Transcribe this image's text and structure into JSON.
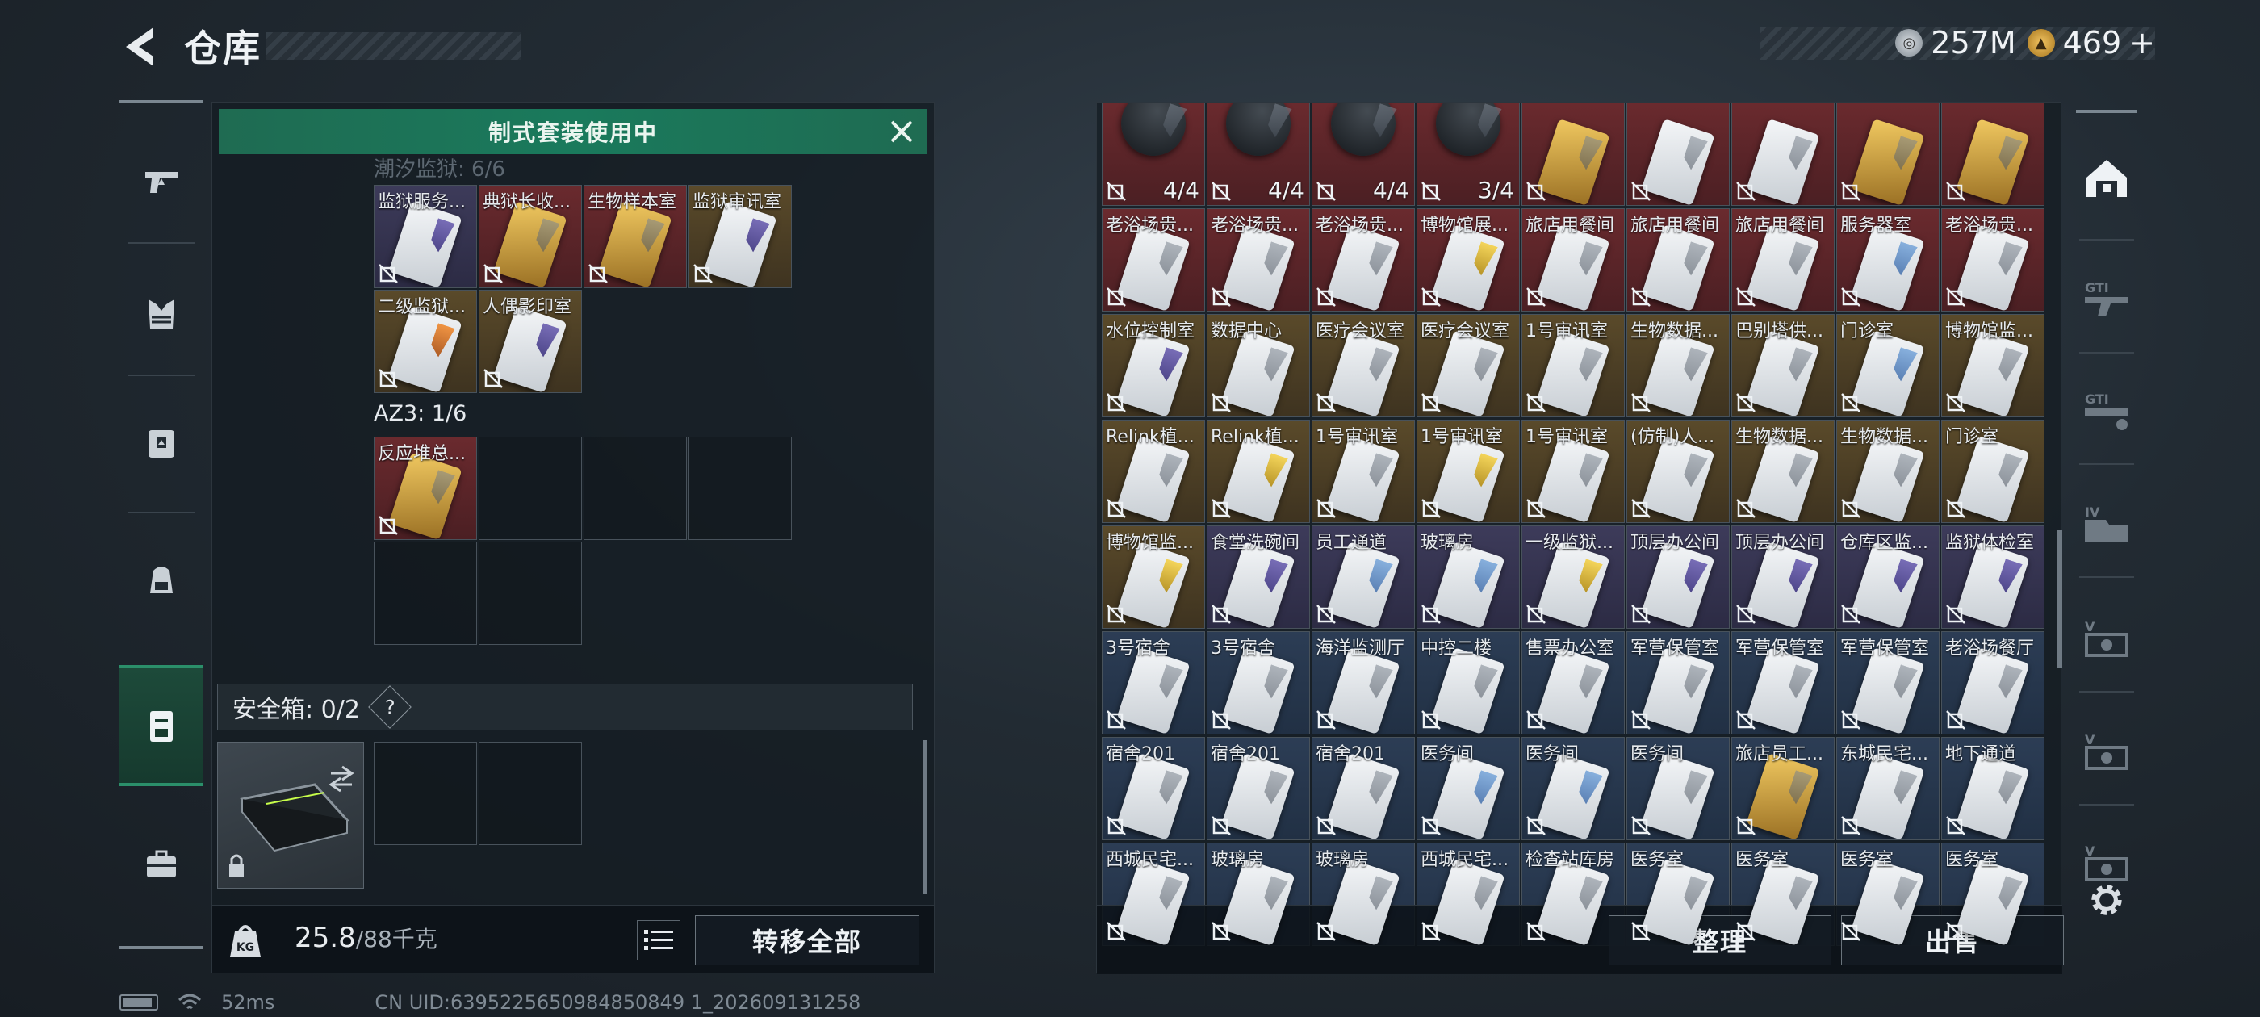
{
  "header": {
    "title": "仓库"
  },
  "currency": {
    "silver": "257M",
    "gold": "469",
    "gold_plus": "+"
  },
  "left_nav": [
    "pistol-icon",
    "armor-vest-icon",
    "chest-rig-icon",
    "backpack-icon",
    "keycard-case-icon",
    "briefcase-icon"
  ],
  "left_panel": {
    "banner": "制式套装使用中",
    "faded_section": "潮汐监狱: 6/6",
    "prison_items": [
      {
        "label": "监狱服务...",
        "rarity": "purple",
        "card": "purple"
      },
      {
        "label": "典狱长收...",
        "rarity": "red",
        "card": "gold"
      },
      {
        "label": "生物样本室",
        "rarity": "red",
        "card": "gold"
      },
      {
        "label": "监狱审讯室",
        "rarity": "gold",
        "card": "purple"
      },
      {
        "label": "二级监狱...",
        "rarity": "gold",
        "card": "orange"
      },
      {
        "label": "人偶影印室",
        "rarity": "gold",
        "card": "purple"
      }
    ],
    "az3_label": "AZ3: 1/6",
    "az3_items": [
      {
        "label": "反应堆总...",
        "rarity": "red",
        "card": "gold"
      }
    ],
    "safe_box_label": "安全箱: 0/2",
    "help": "?",
    "weight_current": "25.8",
    "weight_max": "/88千克",
    "transfer_all": "转移全部"
  },
  "right_panel": {
    "items": [
      {
        "label": "",
        "rarity": "red",
        "card": "dark",
        "qty": "4/4"
      },
      {
        "label": "",
        "rarity": "red",
        "card": "dark",
        "qty": "4/4"
      },
      {
        "label": "",
        "rarity": "red",
        "card": "dark",
        "qty": "4/4"
      },
      {
        "label": "",
        "rarity": "red",
        "card": "dark",
        "qty": "3/4"
      },
      {
        "label": "",
        "rarity": "red",
        "card": "gold",
        "qty": ""
      },
      {
        "label": "",
        "rarity": "red",
        "card": "plain",
        "qty": ""
      },
      {
        "label": "",
        "rarity": "red",
        "card": "plain",
        "qty": ""
      },
      {
        "label": "",
        "rarity": "red",
        "card": "gold",
        "qty": ""
      },
      {
        "label": "",
        "rarity": "red",
        "card": "gold",
        "qty": ""
      },
      {
        "label": "老浴场贵...",
        "rarity": "red",
        "card": "plain",
        "qty": ""
      },
      {
        "label": "老浴场贵...",
        "rarity": "red",
        "card": "plain",
        "qty": ""
      },
      {
        "label": "老浴场贵...",
        "rarity": "red",
        "card": "plain",
        "qty": ""
      },
      {
        "label": "博物馆展...",
        "rarity": "red",
        "card": "yellow",
        "qty": ""
      },
      {
        "label": "旅店用餐间",
        "rarity": "red",
        "card": "plain",
        "qty": ""
      },
      {
        "label": "旅店用餐间",
        "rarity": "red",
        "card": "plain",
        "qty": ""
      },
      {
        "label": "旅店用餐间",
        "rarity": "red",
        "card": "plain",
        "qty": ""
      },
      {
        "label": "服务器室",
        "rarity": "red",
        "card": "blue",
        "qty": ""
      },
      {
        "label": "老浴场贵...",
        "rarity": "red",
        "card": "plain",
        "qty": ""
      },
      {
        "label": "水位控制室",
        "rarity": "gold",
        "card": "purple",
        "qty": ""
      },
      {
        "label": "数据中心",
        "rarity": "gold",
        "card": "plain",
        "qty": ""
      },
      {
        "label": "医疗会议室",
        "rarity": "gold",
        "card": "plain",
        "qty": ""
      },
      {
        "label": "医疗会议室",
        "rarity": "gold",
        "card": "plain",
        "qty": ""
      },
      {
        "label": "1号审讯室",
        "rarity": "gold",
        "card": "plain",
        "qty": ""
      },
      {
        "label": "生物数据...",
        "rarity": "gold",
        "card": "plain",
        "qty": ""
      },
      {
        "label": "巴别塔供...",
        "rarity": "gold",
        "card": "plain",
        "qty": ""
      },
      {
        "label": "门诊室",
        "rarity": "gold",
        "card": "blue",
        "qty": ""
      },
      {
        "label": "博物馆监...",
        "rarity": "gold",
        "card": "plain",
        "qty": ""
      },
      {
        "label": "Relink植...",
        "rarity": "gold",
        "card": "plain",
        "qty": ""
      },
      {
        "label": "Relink植...",
        "rarity": "gold",
        "card": "yellow",
        "qty": ""
      },
      {
        "label": "1号审讯室",
        "rarity": "gold",
        "card": "plain",
        "qty": ""
      },
      {
        "label": "1号审讯室",
        "rarity": "gold",
        "card": "yellow",
        "qty": ""
      },
      {
        "label": "1号审讯室",
        "rarity": "gold",
        "card": "plain",
        "qty": ""
      },
      {
        "label": "(仿制)人...",
        "rarity": "gold",
        "card": "plain",
        "qty": ""
      },
      {
        "label": "生物数据...",
        "rarity": "gold",
        "card": "plain",
        "qty": ""
      },
      {
        "label": "生物数据...",
        "rarity": "gold",
        "card": "plain",
        "qty": ""
      },
      {
        "label": "门诊室",
        "rarity": "gold",
        "card": "plain",
        "qty": ""
      },
      {
        "label": "博物馆监...",
        "rarity": "gold",
        "card": "yellow",
        "qty": ""
      },
      {
        "label": "食堂洗碗间",
        "rarity": "purple",
        "card": "purple",
        "qty": ""
      },
      {
        "label": "员工通道",
        "rarity": "purple",
        "card": "blue",
        "qty": ""
      },
      {
        "label": "玻璃房",
        "rarity": "purple",
        "card": "blue",
        "qty": ""
      },
      {
        "label": "一级监狱...",
        "rarity": "purple",
        "card": "yellow",
        "qty": ""
      },
      {
        "label": "顶层办公间",
        "rarity": "purple",
        "card": "purple",
        "qty": ""
      },
      {
        "label": "顶层办公间",
        "rarity": "purple",
        "card": "purple",
        "qty": ""
      },
      {
        "label": "仓库区监...",
        "rarity": "purple",
        "card": "purple",
        "qty": ""
      },
      {
        "label": "监狱体检室",
        "rarity": "purple",
        "card": "purple",
        "qty": ""
      },
      {
        "label": "3号宿舍",
        "rarity": "blue",
        "card": "plain",
        "qty": ""
      },
      {
        "label": "3号宿舍",
        "rarity": "blue",
        "card": "plain",
        "qty": ""
      },
      {
        "label": "海洋监测厅",
        "rarity": "blue",
        "card": "plain",
        "qty": ""
      },
      {
        "label": "中控二楼",
        "rarity": "blue",
        "card": "plain",
        "qty": ""
      },
      {
        "label": "售票办公室",
        "rarity": "blue",
        "card": "plain",
        "qty": ""
      },
      {
        "label": "军营保管室",
        "rarity": "blue",
        "card": "plain",
        "qty": ""
      },
      {
        "label": "军营保管室",
        "rarity": "blue",
        "card": "plain",
        "qty": ""
      },
      {
        "label": "军营保管室",
        "rarity": "blue",
        "card": "plain",
        "qty": ""
      },
      {
        "label": "老浴场餐厅",
        "rarity": "blue",
        "card": "plain",
        "qty": ""
      },
      {
        "label": "宿舍201",
        "rarity": "blue",
        "card": "plain",
        "qty": ""
      },
      {
        "label": "宿舍201",
        "rarity": "blue",
        "card": "plain",
        "qty": ""
      },
      {
        "label": "宿舍201",
        "rarity": "blue",
        "card": "plain",
        "qty": ""
      },
      {
        "label": "医务间",
        "rarity": "blue",
        "card": "blue",
        "qty": ""
      },
      {
        "label": "医务间",
        "rarity": "blue",
        "card": "blue",
        "qty": ""
      },
      {
        "label": "医务间",
        "rarity": "blue",
        "card": "plain",
        "qty": ""
      },
      {
        "label": "旅店员工...",
        "rarity": "blue",
        "card": "gold",
        "qty": ""
      },
      {
        "label": "东城民宅...",
        "rarity": "blue",
        "card": "plain",
        "qty": ""
      },
      {
        "label": "地下通道",
        "rarity": "blue",
        "card": "plain",
        "qty": ""
      },
      {
        "label": "西城民宅...",
        "rarity": "blue",
        "card": "plain",
        "qty": ""
      },
      {
        "label": "玻璃房",
        "rarity": "blue",
        "card": "plain",
        "qty": ""
      },
      {
        "label": "玻璃房",
        "rarity": "blue",
        "card": "plain",
        "qty": ""
      },
      {
        "label": "西城民宅...",
        "rarity": "blue",
        "card": "plain",
        "qty": ""
      },
      {
        "label": "检查站库房",
        "rarity": "blue",
        "card": "plain",
        "qty": ""
      },
      {
        "label": "医务室",
        "rarity": "blue",
        "card": "plain",
        "qty": ""
      },
      {
        "label": "医务室",
        "rarity": "blue",
        "card": "plain",
        "qty": ""
      },
      {
        "label": "医务室",
        "rarity": "blue",
        "card": "plain",
        "qty": ""
      },
      {
        "label": "医务室",
        "rarity": "blue",
        "card": "plain",
        "qty": ""
      }
    ],
    "sort_button": "整理",
    "sell_button": "出售"
  },
  "right_nav": [
    "warehouse-icon",
    "weapon-rack-icon",
    "weapon-rack-2-icon",
    "ammo-box-icon",
    "vault-icon",
    "vault-2-icon",
    "vault-3-icon",
    "settings-icon"
  ],
  "status": {
    "ping": "52ms",
    "uid": "CN UID:6395225650984850849 1_202609131258"
  },
  "colors": {
    "accent": "#1f6b52",
    "rarity_red": "#6a2a2e",
    "rarity_gold": "#5a4a2a",
    "rarity_purple": "#3d3b5a",
    "rarity_blue": "#2c3d55"
  }
}
